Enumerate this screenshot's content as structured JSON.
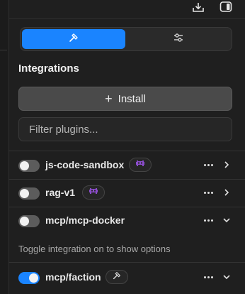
{
  "toolbar": {
    "icons": [
      "download-icon",
      "panel-icon"
    ]
  },
  "tabs": [
    {
      "name": "plugins",
      "icon": "hammer-icon",
      "active": true
    },
    {
      "name": "settings",
      "icon": "sliders-icon",
      "active": false
    }
  ],
  "integrations": {
    "title": "Integrations",
    "install_label": "Install",
    "filter_placeholder": "Filter plugins..."
  },
  "plugins": [
    {
      "name": "js-code-sandbox",
      "enabled": false,
      "badge_icon": "alien-icon",
      "expanded": false
    },
    {
      "name": "rag-v1",
      "enabled": false,
      "badge_icon": "alien-icon",
      "expanded": false
    },
    {
      "name": "mcp/mcp-docker",
      "enabled": false,
      "badge_icon": null,
      "expanded": true
    },
    {
      "name": "mcp/faction",
      "enabled": true,
      "badge_icon": "hammer-icon",
      "expanded": true
    }
  ],
  "hint": "Toggle integration on to show options",
  "colors": {
    "accent": "#1a84ff",
    "background": "#1f1f1f",
    "badge_alien": "#8a4cc9"
  }
}
